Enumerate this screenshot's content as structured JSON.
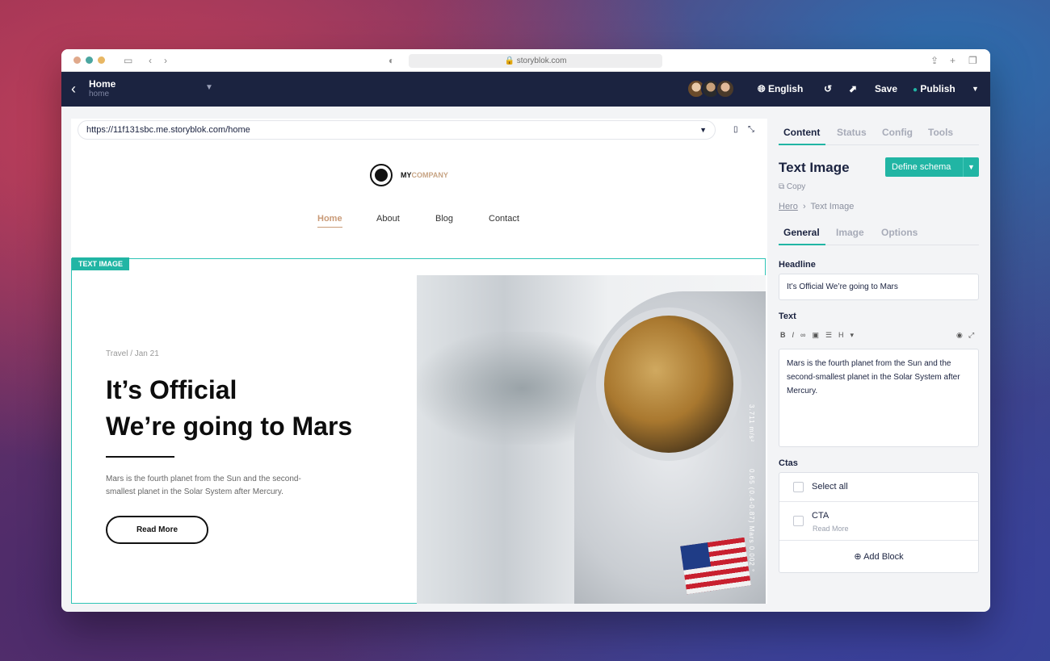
{
  "browser": {
    "address": "storyblok.com",
    "traffic_colors": [
      "#e0a98b",
      "#4aa6a0",
      "#e8b764"
    ]
  },
  "header": {
    "page_title": "Home",
    "page_slug": "home",
    "language": "English",
    "save_label": "Save",
    "publish_label": "Publish",
    "publish_status_color": "#21b5a4",
    "brand_color": "#1b2340"
  },
  "preview": {
    "url": "https://11f131sbc.me.storyblok.com/home"
  },
  "site": {
    "logo_my": "MY",
    "logo_company": "COMPANY",
    "nav": [
      {
        "label": "Home"
      },
      {
        "label": "About"
      },
      {
        "label": "Blog"
      },
      {
        "label": "Contact"
      }
    ],
    "block_tag": "TEXT IMAGE",
    "meta": "Travel / Jan 21",
    "headline_line1": "It’s Official",
    "headline_line2": "We’re going to Mars",
    "body": "Mars is the fourth planet from the Sun and the second-smallest planet in the Solar System after Mercury.",
    "cta": "Read More",
    "photo_text_1": "3.711 m/s²",
    "photo_text_2": "0.65 (0.4-0.87) Mars 0.002 °"
  },
  "panel": {
    "tabs": [
      {
        "label": "Content"
      },
      {
        "label": "Status"
      },
      {
        "label": "Config"
      },
      {
        "label": "Tools"
      }
    ],
    "component_title": "Text Image",
    "define_schema": "Define schema",
    "copy": "Copy",
    "breadcrumb_parent": "Hero",
    "breadcrumb_current": "Text Image",
    "subtabs": [
      {
        "label": "General"
      },
      {
        "label": "Image"
      },
      {
        "label": "Options"
      }
    ],
    "headline_label": "Headline",
    "headline_value": "It’s Official We’re going to Mars",
    "text_label": "Text",
    "text_value": "Mars is the fourth planet from the Sun and the second-smallest planet in the Solar System after Mercury.",
    "ctas_label": "Ctas",
    "select_all": "Select all",
    "cta_item_title": "CTA",
    "cta_item_sub": "Read More",
    "add_block": "Add Block",
    "accent": "#21b5a4"
  }
}
